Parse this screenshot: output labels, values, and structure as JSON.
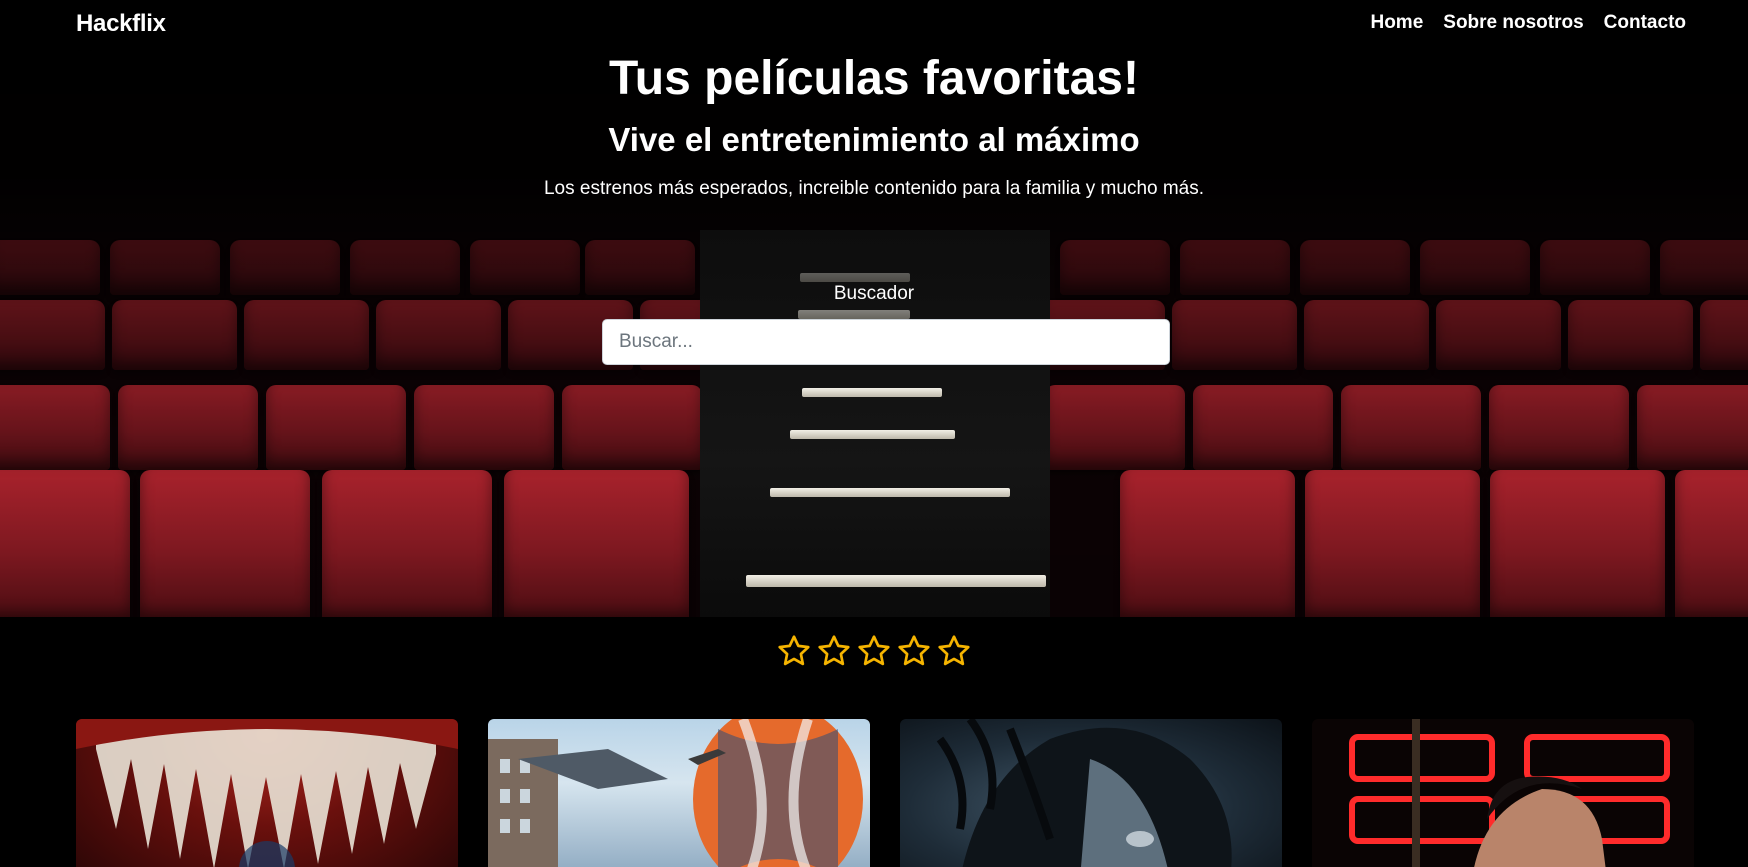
{
  "nav": {
    "brand": "Hackflix",
    "links": [
      "Home",
      "Sobre nosotros",
      "Contacto"
    ]
  },
  "hero": {
    "title": "Tus películas favoritas!",
    "subtitle": "Vive el entretenimiento al máximo",
    "description": "Los estrenos más esperados, increible contenido para la familia y mucho más."
  },
  "search": {
    "label": "Buscador",
    "placeholder": "Buscar...",
    "value": ""
  },
  "rating": {
    "max_stars": 5,
    "selected": 0,
    "star_color": "#f5b400"
  },
  "movies": [
    {
      "icon": "poster-image"
    },
    {
      "icon": "poster-image"
    },
    {
      "icon": "poster-image"
    },
    {
      "icon": "poster-image"
    }
  ],
  "colors": {
    "background": "#000000",
    "seat_red": "#8e1b24",
    "text": "#ffffff"
  }
}
